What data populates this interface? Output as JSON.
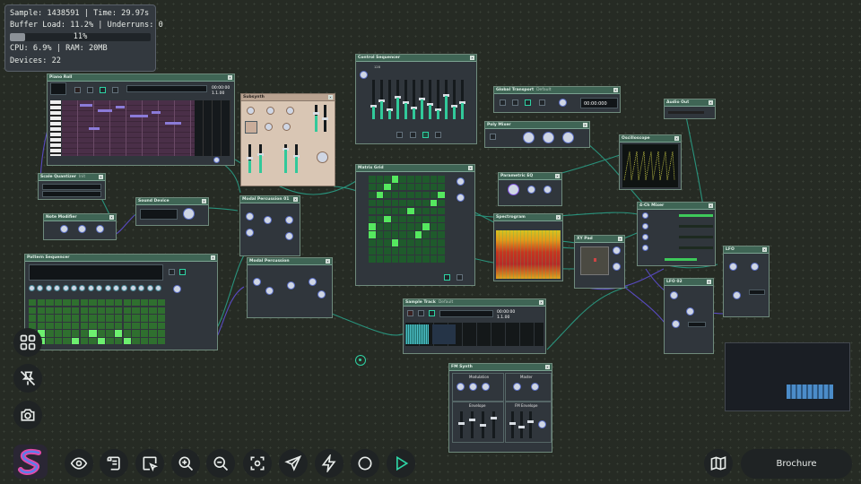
{
  "stats": {
    "line1": "Sample: 1438591 | Time: 29.97s",
    "line2": "Buffer Load: 11.2% | Underruns: 0",
    "buffer_percent": "11%",
    "buffer_fill": 0.11,
    "line3": "CPU: 6.9% | RAM: 20MB",
    "line4": "Devices: 22"
  },
  "modules": {
    "piano_roll": {
      "title": "Piano Roll",
      "time": "00:00:00",
      "bars": "1.1.00"
    },
    "subsynth": {
      "title": "Subsynth"
    },
    "step_sequencer": {
      "title": "Control Sequencer",
      "tempo": "128"
    },
    "transport": {
      "title": "Global Transport",
      "sub": "Default",
      "time": "00:00:000"
    },
    "audio_out": {
      "title": "Audio Out"
    },
    "scale_quantizer": {
      "title": "Scale Quantizer",
      "sub": "Init"
    },
    "sound_device": {
      "title": "Sound Device"
    },
    "note_modifier": {
      "title": "Note Modifier"
    },
    "modal_perc_1": {
      "title": "Modal Percussion 01"
    },
    "modal_perc_2": {
      "title": "Modal Percussion"
    },
    "matrix_grid": {
      "title": "Matrix Grid"
    },
    "poly_mixer": {
      "title": "Poly Mixer"
    },
    "parametric_eq": {
      "title": "Parametric EQ"
    },
    "oscilloscope": {
      "title": "Oscilloscope"
    },
    "spectrogram": {
      "title": "Spectrogram"
    },
    "xy_pad": {
      "title": "XY Pad"
    },
    "mixer": {
      "title": "4-Ch Mixer"
    },
    "lfo": {
      "title": "LFO"
    },
    "lfo2": {
      "title": "LFO 02"
    },
    "drum_seq": {
      "title": "Pattern Sequencer"
    },
    "sample_track": {
      "title": "Sample Track",
      "sub": "Default",
      "time": "00:00:00",
      "bars": "1.1.00"
    },
    "fm_synth": {
      "title": "FM Synth",
      "modulation": "Modulation",
      "master": "Master",
      "envelope": "Envelope",
      "fm_envelope": "FM Envelope"
    }
  },
  "toolbar": {
    "left_icons": [
      "grid-icon",
      "unpin-icon",
      "camera-icon"
    ],
    "bottom_icons": [
      "eye-icon",
      "scroll-icon",
      "select-icon",
      "zoom-in-icon",
      "zoom-out-icon",
      "fit-view-icon",
      "send-icon",
      "bolt-icon",
      "record-icon",
      "play-icon"
    ],
    "map_icon": "map-icon",
    "brochure_label": "Brochure"
  },
  "colors": {
    "accent": "#2ed3a4",
    "wire": "#2aa38a",
    "wire_purple": "#5d4fd0",
    "module_header": "#3f6555"
  }
}
